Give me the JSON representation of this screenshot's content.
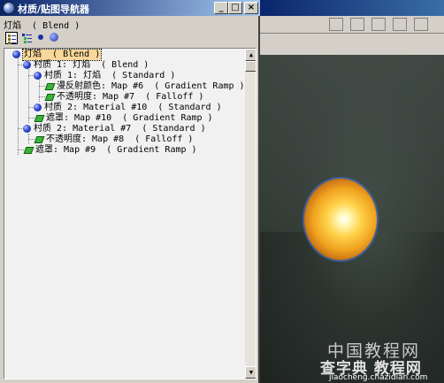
{
  "window": {
    "title": "材质/贴图导航器",
    "minimize_glyph": "_",
    "maximize_glyph": "□",
    "close_glyph": "×"
  },
  "path_bar": {
    "text": "灯焰  ( Blend )"
  },
  "toolbar": {
    "icons": [
      "view-list-icon",
      "view-list-icons-icon",
      "view-small-icons-icon",
      "view-large-icons-icon"
    ]
  },
  "tree": {
    "items": [
      {
        "label": "灯焰  ( Blend )",
        "type": "material",
        "level": 0,
        "selected": true
      },
      {
        "label": "村质 1: 灯焰  ( Blend )",
        "type": "material",
        "level": 1
      },
      {
        "label": "村质 1: 灯焰  ( Standard )",
        "type": "material",
        "level": 2
      },
      {
        "label": "漫反射颜色: Map #6  ( Gradient Ramp )",
        "type": "map",
        "level": 3
      },
      {
        "label": "不透明度: Map #7  ( Falloff )",
        "type": "map",
        "level": 3
      },
      {
        "label": "村质 2: Material #10  ( Standard )",
        "type": "material",
        "level": 2
      },
      {
        "label": "遮罩: Map #10  ( Gradient Ramp )",
        "type": "map",
        "level": 2
      },
      {
        "label": "村质 2: Material #7  ( Standard )",
        "type": "material",
        "level": 1
      },
      {
        "label": "不透明度: Map #8  ( Falloff )",
        "type": "map",
        "level": 2
      },
      {
        "label": "遮罩: Map #9  ( Gradient Ramp )",
        "type": "map",
        "level": 1
      }
    ]
  },
  "scrollbar": {
    "up_glyph": "▲",
    "down_glyph": "▼"
  },
  "viewport": {
    "dropdown_glyph": "▼",
    "watermark_line1": "中国教程网",
    "watermark_line2": "查字典 教程网",
    "watermark_url": "jiaocheng.chazidian.com"
  },
  "colors": {
    "titlebar_start": "#0a246a",
    "titlebar_end": "#a6caf0",
    "selection": "#f7d89a",
    "material_sphere": "#3348d0",
    "map_icon": "#3ab33a"
  }
}
